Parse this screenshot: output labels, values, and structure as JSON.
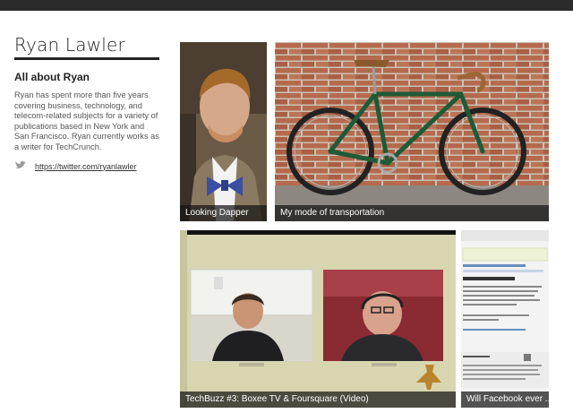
{
  "profile": {
    "name": "Ryan Lawler",
    "about_title": "All about Ryan",
    "bio": "Ryan has spent more than five years covering business, technology, and telecom-related subjects for a variety of publications based in New York and San Francisco. Ryan currently works as a writer for TechCrunch.",
    "twitter_url": "https://twitter.com/ryanlawler"
  },
  "tiles": [
    {
      "label": "Looking Dapper"
    },
    {
      "label": "My mode of transportation"
    },
    {
      "label": "TechBuzz #3: Boxee TV & Foursquare (Video)"
    },
    {
      "label": "Will Facebook ever ..."
    }
  ],
  "icons": {
    "twitter": "bird-icon"
  },
  "colors": {
    "topbar": "#2b2b2b",
    "label_bg": "#1e1e1e",
    "bike_frame": "#1f5a37",
    "brick": "#b2664c"
  }
}
